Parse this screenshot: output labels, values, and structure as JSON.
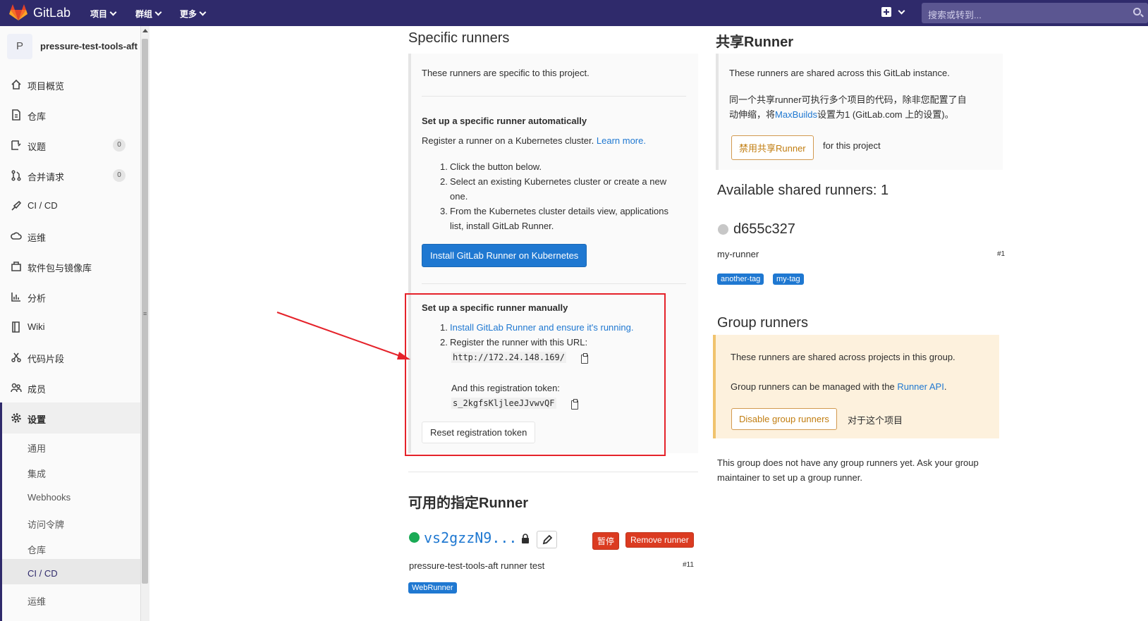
{
  "navbar": {
    "logo_text": "GitLab",
    "menus": [
      "项目",
      "群组",
      "更多"
    ],
    "search_placeholder": "搜索或转到..."
  },
  "sidebar": {
    "project_initial": "P",
    "project_name": "pressure-test-tools-aft",
    "items": [
      {
        "label": "项目概览",
        "icon": "home-icon"
      },
      {
        "label": "仓库",
        "icon": "doc-icon"
      },
      {
        "label": "议题",
        "icon": "issues-icon",
        "count": "0"
      },
      {
        "label": "合并请求",
        "icon": "merge-request-icon",
        "count": "0"
      },
      {
        "label": "CI / CD",
        "icon": "rocket-icon"
      },
      {
        "label": "运维",
        "icon": "cloud-icon"
      },
      {
        "label": "软件包与镜像库",
        "icon": "package-icon"
      },
      {
        "label": "分析",
        "icon": "chart-icon"
      },
      {
        "label": "Wiki",
        "icon": "book-icon"
      },
      {
        "label": "代码片段",
        "icon": "scissors-icon"
      },
      {
        "label": "成员",
        "icon": "users-icon"
      },
      {
        "label": "设置",
        "icon": "gear-icon"
      }
    ],
    "sub_items": [
      "通用",
      "集成",
      "Webhooks",
      "访问令牌",
      "仓库",
      "CI / CD",
      "运维"
    ]
  },
  "specific": {
    "title": "Specific runners",
    "intro": "These runners are specific to this project.",
    "auto_title": "Set up a specific runner automatically",
    "auto_desc": "Register a runner on a Kubernetes cluster.",
    "learn_more": "Learn more.",
    "steps": [
      "Click the button below.",
      "Select an existing Kubernetes cluster or create a new",
      "one.",
      "From the Kubernetes cluster details view, applications",
      "list, install GitLab Runner."
    ],
    "step_numbers": [
      "1.",
      "2.",
      "3."
    ],
    "install_button": "Install GitLab Runner on Kubernetes",
    "manual_title": "Set up a specific runner manually",
    "manual_step1": "Install GitLab Runner and ensure it's running.",
    "manual_step2": "Register the runner with this URL:",
    "url": "http://172.24.148.169/",
    "token_label": "And this registration token:",
    "token": "s_2kgfsKljleeJJvwvQF",
    "reset_button": "Reset registration token"
  },
  "available_specific": {
    "title": "可用的指定Runner",
    "runner_name": "vs2gzzN9...",
    "pause_button": "暂停",
    "remove_button": "Remove runner",
    "description": "pressure-test-tools-aft runner test",
    "id": "#11",
    "tags": [
      "WebRunner"
    ],
    "status_color": "#1aaa55"
  },
  "shared": {
    "title": "共享Runner",
    "intro": "These runners are shared across this GitLab instance.",
    "note_line1": "同一个共享runner可执行多个项目的代码，除非您配置了自",
    "note_line2_a": "动伸缩，将",
    "note_link": "MaxBuilds",
    "note_line2_b": "设置为1 (GitLab.com 上的设置)。",
    "disable_button": "禁用共享Runner",
    "for_project": "for this project",
    "available_title": "Available shared runners: 1",
    "runner_name": "d655c327",
    "runner_desc": "my-runner",
    "runner_id": "#1",
    "tags": [
      "another-tag",
      "my-tag"
    ],
    "status_color": "#c7c7c7"
  },
  "group": {
    "title": "Group runners",
    "intro": "These runners are shared across projects in this group.",
    "manage_text": "Group runners can be managed with the",
    "manage_link": "Runner API",
    "manage_end": ".",
    "disable_button": "Disable group runners",
    "for_project": "对于这个项目",
    "empty_line1": "This group does not have any group runners yet. Ask your group",
    "empty_line2": "maintainer to set up a group runner."
  },
  "colors": {
    "navbar": "#2f2a6b",
    "link": "#1f78d1",
    "danger": "#db3b21",
    "annotation": "#e5222a"
  }
}
